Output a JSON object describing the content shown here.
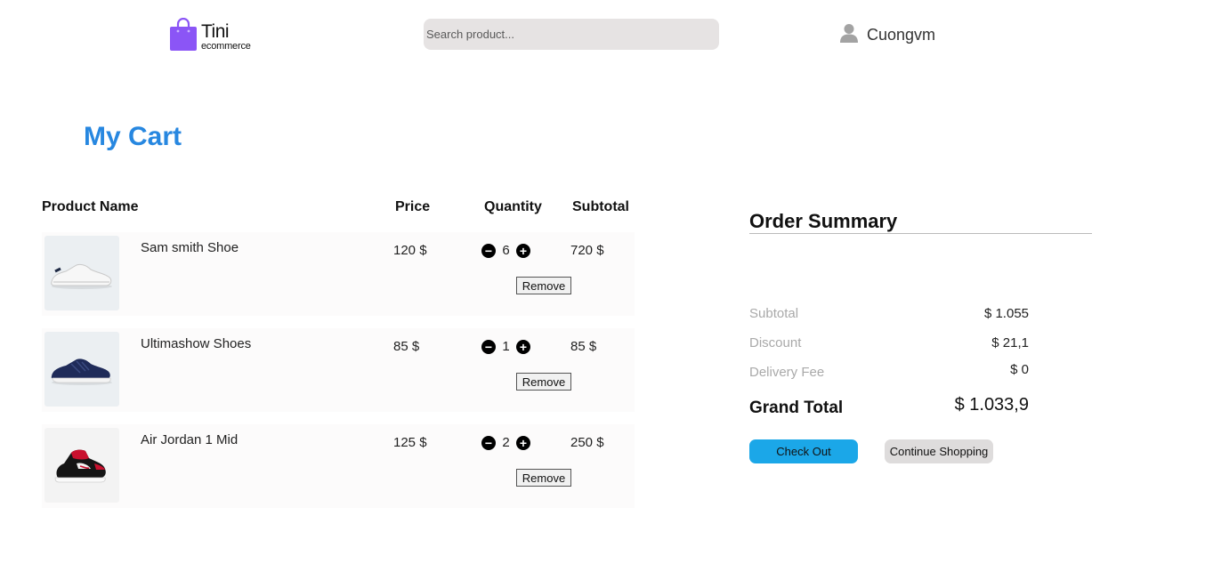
{
  "header": {
    "logo_name": "Tini",
    "logo_sub": "ecommerce",
    "logo_icon": "shopping-bag-icon",
    "search_placeholder": "Search product...",
    "search_value": "",
    "user_icon": "user-icon",
    "username": "Cuongvm"
  },
  "page_title": "My Cart",
  "table": {
    "headers": {
      "product": "Product Name",
      "price": "Price",
      "quantity": "Quantity",
      "subtotal": "Subtotal"
    },
    "minus_icon": "minus-circle-icon",
    "plus_icon": "plus-circle-icon",
    "remove_label": "Remove",
    "items": [
      {
        "name": "Sam smith Shoe",
        "price": "120 $",
        "quantity": "6",
        "subtotal": "720 $",
        "image": "white-sneaker",
        "minus": "−",
        "plus": "+"
      },
      {
        "name": "Ultimashow Shoes",
        "price": "85 $",
        "quantity": "1",
        "subtotal": "85 $",
        "image": "navy-sneaker",
        "minus": "−",
        "plus": "+"
      },
      {
        "name": "Air Jordan 1 Mid",
        "price": "125 $",
        "quantity": "2",
        "subtotal": "250 $",
        "image": "red-black-sneaker",
        "minus": "−",
        "plus": "+"
      }
    ]
  },
  "summary": {
    "title": "Order Summary",
    "subtotal_label": "Subtotal",
    "subtotal_value": "$ 1.055",
    "discount_label": "Discount",
    "discount_value": "$ 21,1",
    "delivery_label": "Delivery Fee",
    "delivery_value": "$ 0",
    "grand_label": "Grand Total",
    "grand_value": "$ 1.033,9",
    "checkout_label": "Check Out",
    "continue_label": "Continue Shopping"
  },
  "colors": {
    "accent_title": "#2787e0",
    "checkout_button": "#1ba7e8",
    "logo_purple": "#8b55f6",
    "search_bg": "#e6e3e3"
  }
}
